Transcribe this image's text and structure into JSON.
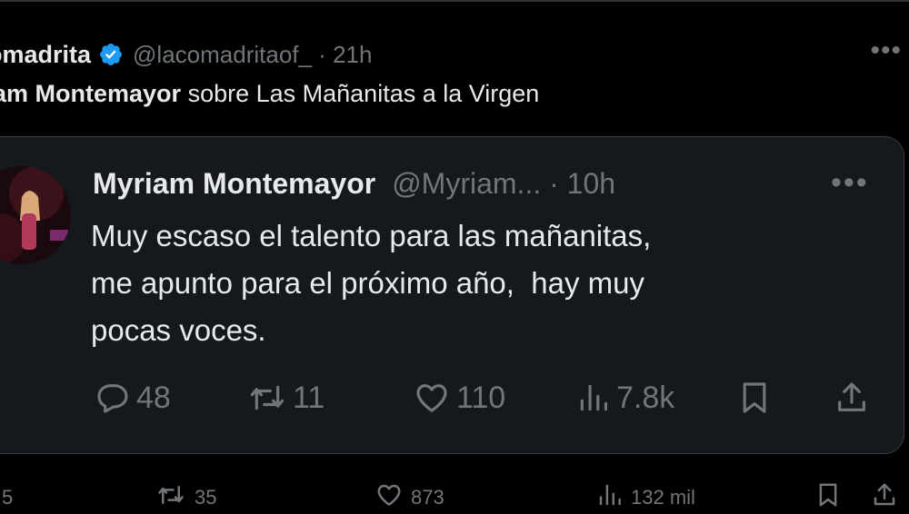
{
  "post": {
    "author_name": "omadrita",
    "handle_time": "@lacomadritaof_ · 21h",
    "more": "•••",
    "text_bold": "am Montemayor",
    "text_rest": " sobre Las Mañanitas a la Virgen"
  },
  "quoted": {
    "name": "Myriam Montemayor",
    "handle_time": "@Myriam... · 10h",
    "more": "•••",
    "lines": [
      "Muy escaso el talento para las mañanitas,",
      "me apunto para el próximo año,  hay muy",
      "pocas voces."
    ],
    "actions": {
      "replies": "48",
      "reposts": "11",
      "likes": "110",
      "views": "7.8k"
    }
  },
  "post_actions": {
    "replies": "5",
    "reposts": "35",
    "likes": "873",
    "views": "132 mil"
  },
  "colors": {
    "background": "#000000",
    "card": "#15181c",
    "text": "#e7e9ea",
    "muted": "#71767b",
    "verified": "#1d9bf0"
  },
  "icons": [
    "verified-badge-icon",
    "reply-icon",
    "repost-icon",
    "like-icon",
    "views-icon",
    "bookmark-icon",
    "share-icon",
    "more-icon"
  ]
}
